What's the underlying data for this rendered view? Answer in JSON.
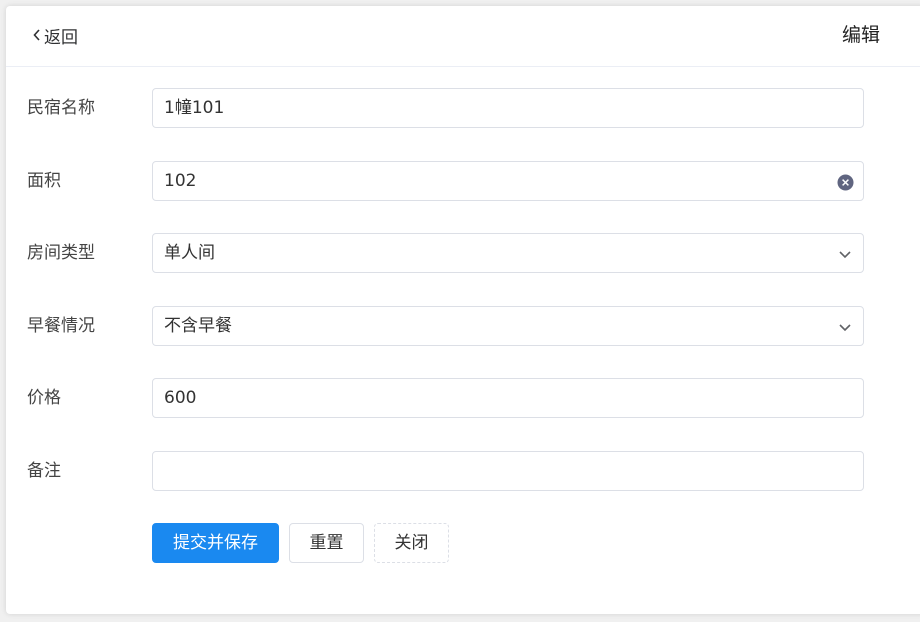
{
  "header": {
    "back_label": "返回",
    "title": "编辑"
  },
  "form": {
    "name": {
      "label": "民宿名称",
      "value": "1幢101"
    },
    "area": {
      "label": "面积",
      "value": "102"
    },
    "room_type": {
      "label": "房间类型",
      "value": "单人间"
    },
    "breakfast": {
      "label": "早餐情况",
      "value": "不含早餐"
    },
    "price": {
      "label": "价格",
      "value": "600"
    },
    "remark": {
      "label": "备注",
      "value": ""
    }
  },
  "buttons": {
    "submit": "提交并保存",
    "reset": "重置",
    "close": "关闭"
  },
  "colors": {
    "primary": "#1a89f0",
    "border": "#dcdfe6",
    "clear_icon": "#606580"
  },
  "icons": {
    "back": "chevron-left-icon",
    "clear": "clear-circle-icon",
    "select": "chevron-down-icon"
  }
}
